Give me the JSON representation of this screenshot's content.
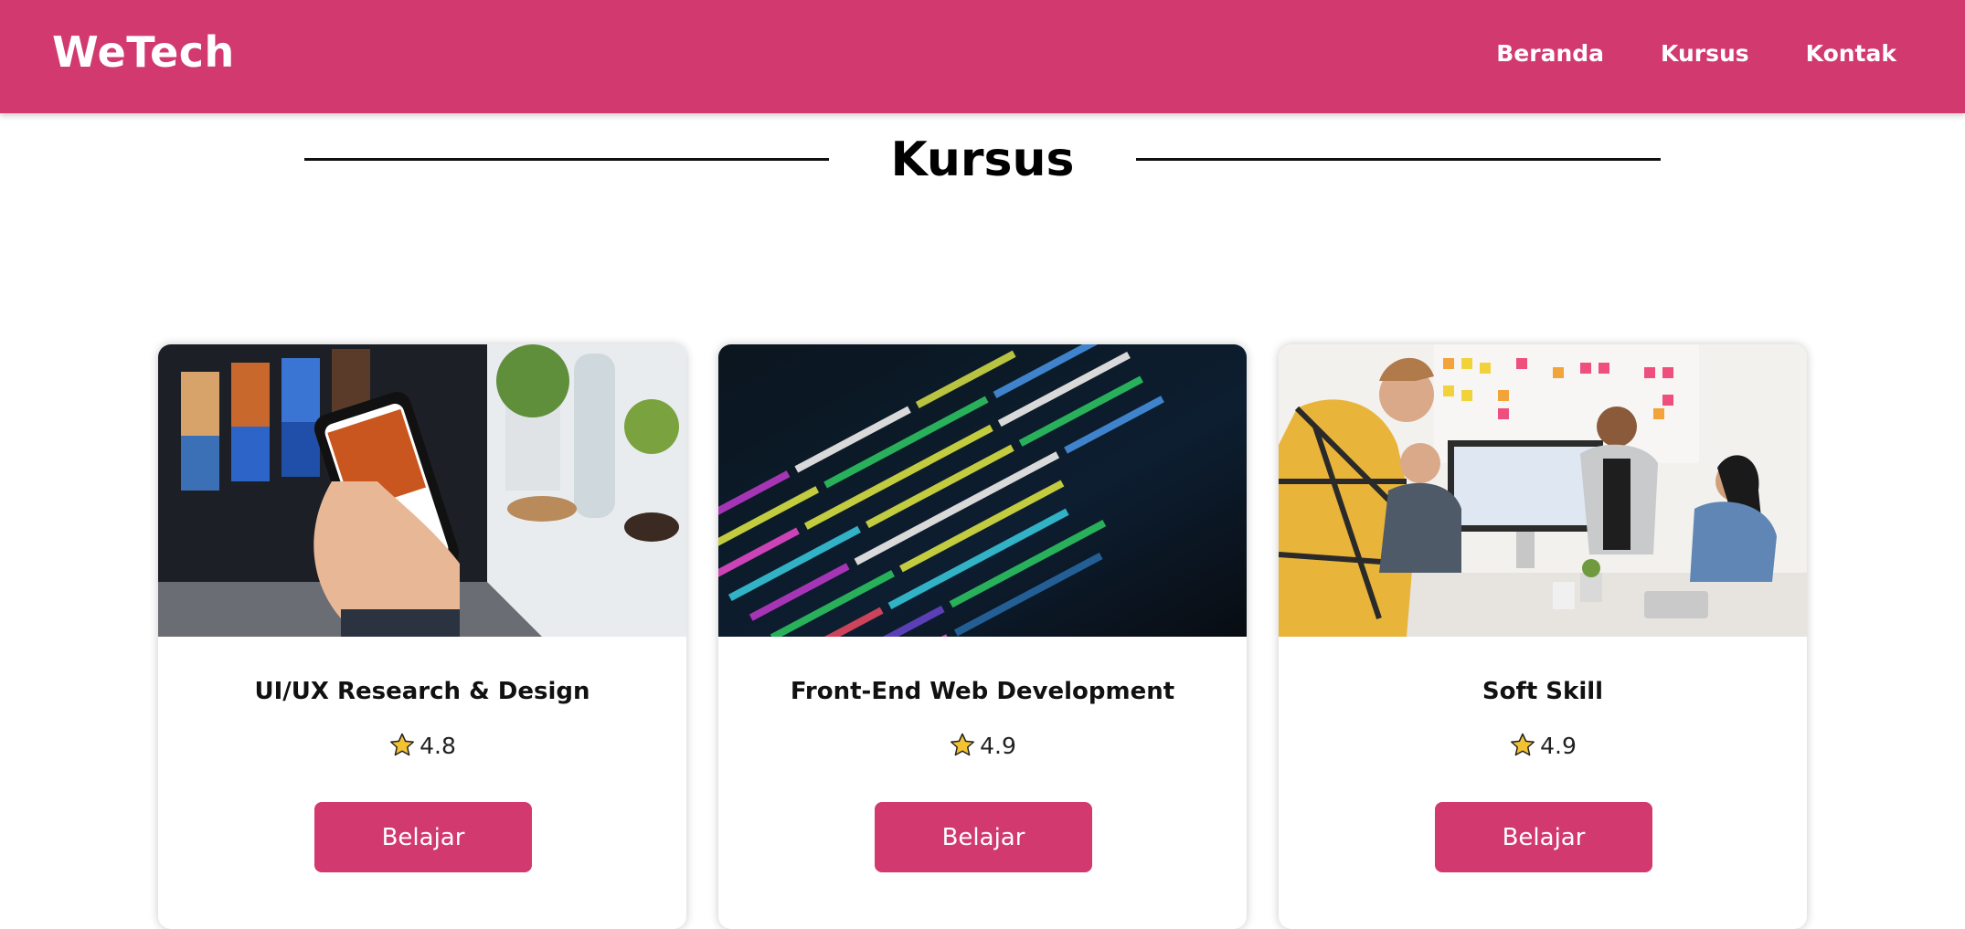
{
  "navbar": {
    "brand": "WeTech",
    "links": [
      "Beranda",
      "Kursus",
      "Kontak"
    ],
    "background_color": "#d1396f"
  },
  "section": {
    "title": "Kursus"
  },
  "courses": [
    {
      "title": "UI/UX Research & Design",
      "rating": "4.8",
      "rating_icon": "star-icon",
      "button_label": "Belajar",
      "image_subject": "hand holding phone in front of laptop showing mobile app designs"
    },
    {
      "title": "Front-End Web Development",
      "rating": "4.9",
      "rating_icon": "star-icon",
      "button_label": "Belajar",
      "image_subject": "colorful source code on dark screen"
    },
    {
      "title": "Soft Skill",
      "rating": "4.9",
      "rating_icon": "star-icon",
      "button_label": "Belajar",
      "image_subject": "team meeting around a table with sticky notes on wall"
    }
  ],
  "colors": {
    "accent": "#d1396f",
    "star_fill": "#f2c233"
  }
}
